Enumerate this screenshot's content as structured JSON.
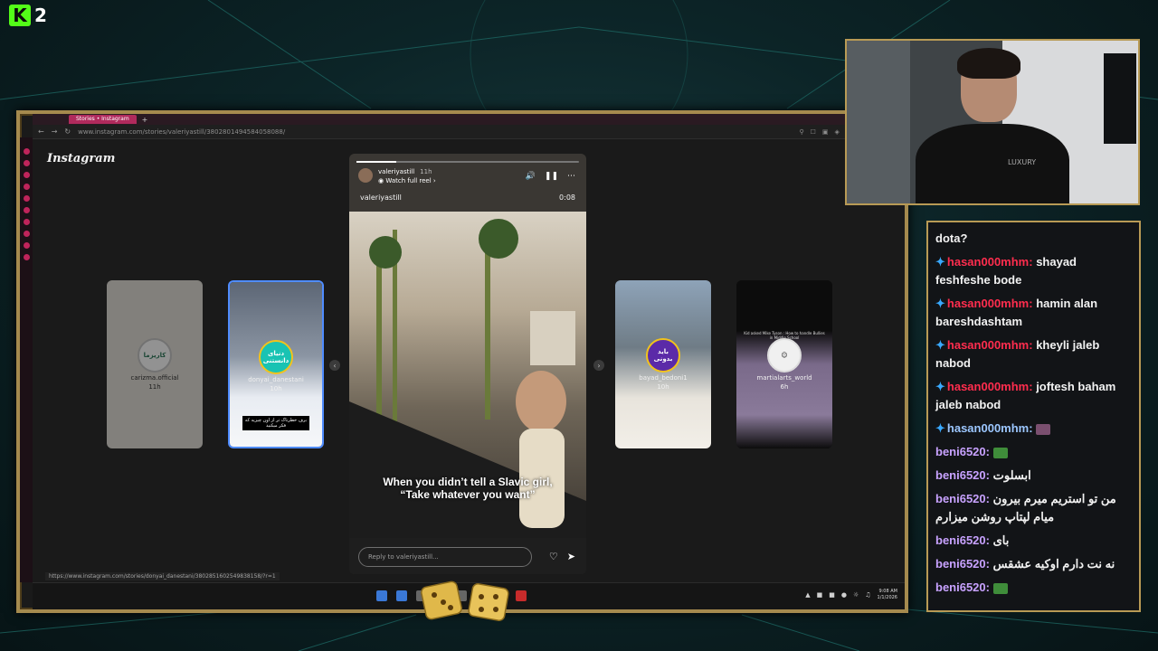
{
  "stream": {
    "logo_letter": "K",
    "logo_number": "2"
  },
  "browser": {
    "tab_title": "Stories • Instagram",
    "tab_plus": "+",
    "url": "www.instagram.com/stories/valeriyastill/3802801494584058088/",
    "status_url": "https://www.instagram.com/stories/donyai_danestani/3802851602549838158/?r=1"
  },
  "instagram": {
    "logo": "Instagram",
    "stories": [
      {
        "username": "carizma.official",
        "time": "11h",
        "avatar_text": "کاریزما"
      },
      {
        "username": "donyai_danestani",
        "time": "10h",
        "avatar_text": "دنیای دانستنی",
        "caption": "برف خطرناک تر از اون چیزیه که فکر میکنید"
      },
      {
        "username": "bayad_bedoni1",
        "time": "10h",
        "avatar_text": "باید بدونی"
      },
      {
        "username": "martialarts_world",
        "time": "6h",
        "avatar_text": "",
        "caption": "Kid asked Mike Tyson : How to handle Bullies in Middle School"
      }
    ],
    "main_story": {
      "username": "valeriyastill",
      "time": "11h",
      "reel_label": "Watch full reel",
      "handle": "valeriyastill",
      "duration": "0:08",
      "caption_line1": "When you didn’t tell a Slavic girl,",
      "caption_line2": "“Take whatever you want”",
      "reply_placeholder": "Reply to valeriyastill..."
    }
  },
  "taskbar": {
    "time": "9:08 AM",
    "date": "1/1/2026"
  },
  "webcam": {
    "shirt_text": "LUXURY"
  },
  "chat": {
    "top_line": "dota?",
    "messages": [
      {
        "user": "hasan000mhm:",
        "text": "shayad feshfeshe bode",
        "color": "red",
        "badge": true
      },
      {
        "user": "hasan000mhm:",
        "text": "hamin alan bareshdashtam",
        "color": "red",
        "badge": true
      },
      {
        "user": "hasan000mhm:",
        "text": "kheyli jaleb nabod",
        "color": "red",
        "badge": true
      },
      {
        "user": "hasan000mhm:",
        "text": "joftesh baham jaleb nabod",
        "color": "red",
        "badge": true
      },
      {
        "user": "hasan000mhm:",
        "text": "",
        "color": "blue",
        "badge": true,
        "emote": "#7a4f6f"
      },
      {
        "user": "beni6520:",
        "text": "",
        "color": "purple",
        "badge": false,
        "emote": "#3f8d3a"
      },
      {
        "user": "beni6520:",
        "text": "ابسلوت",
        "color": "purple",
        "badge": false
      },
      {
        "user": "beni6520:",
        "text": "من تو استریم میرم بیرون میام لپتاپ روشن میزارم",
        "color": "purple",
        "badge": false
      },
      {
        "user": "beni6520:",
        "text": "بای",
        "color": "purple",
        "badge": false
      },
      {
        "user": "beni6520:",
        "text": "نه نت دارم اوکیه عشقس",
        "color": "purple",
        "badge": false
      },
      {
        "user": "beni6520:",
        "text": "",
        "color": "purple",
        "badge": false,
        "emote": "#3f8d3a"
      }
    ]
  },
  "colors": {
    "kick_green": "#53fc18",
    "frame_gold": "#b89a55",
    "nick_red": "#ff2d4e",
    "nick_purple": "#c8a2ff",
    "instagram_tab": "#b02a5c"
  }
}
